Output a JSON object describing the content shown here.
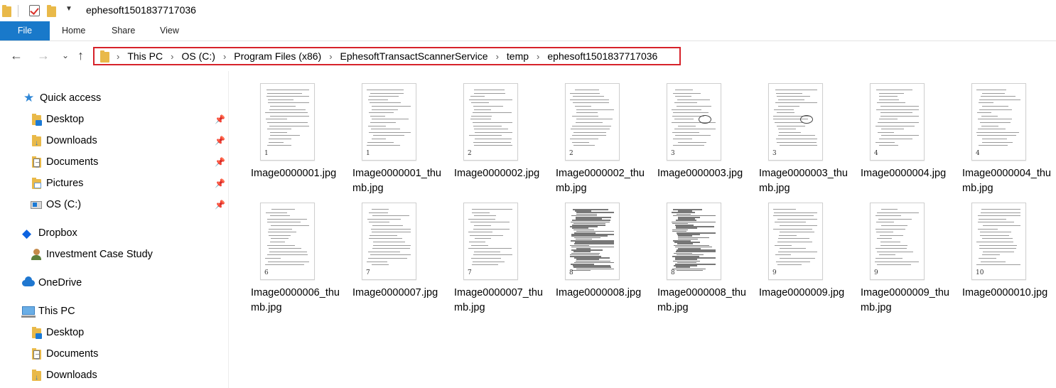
{
  "window": {
    "title": "ephesoft1501837717036"
  },
  "ribbon": {
    "tabs": [
      {
        "label": "File"
      },
      {
        "label": "Home"
      },
      {
        "label": "Share"
      },
      {
        "label": "View"
      }
    ]
  },
  "address_bar": {
    "breadcrumbs": [
      {
        "label": "This PC"
      },
      {
        "label": "OS (C:)"
      },
      {
        "label": "Program Files (x86)"
      },
      {
        "label": "EphesoftTransactScannerService"
      },
      {
        "label": "temp"
      },
      {
        "label": "ephesoft1501837717036"
      }
    ],
    "highlight_color": "#d6222a"
  },
  "sidebar": {
    "items": [
      {
        "label": "Quick access",
        "icon": "star-icon"
      },
      {
        "label": "Desktop",
        "icon": "desktop-folder-icon",
        "pinned": true
      },
      {
        "label": "Downloads",
        "icon": "downloads-folder-icon",
        "pinned": true
      },
      {
        "label": "Documents",
        "icon": "documents-folder-icon",
        "pinned": true
      },
      {
        "label": "Pictures",
        "icon": "pictures-folder-icon",
        "pinned": true
      },
      {
        "label": "OS (C:)",
        "icon": "drive-icon",
        "pinned": true
      },
      {
        "label": "Dropbox",
        "icon": "dropbox-icon"
      },
      {
        "label": "Investment Case Study",
        "icon": "shared-folder-icon"
      },
      {
        "label": "OneDrive",
        "icon": "cloud-icon"
      },
      {
        "label": "This PC",
        "icon": "computer-icon"
      },
      {
        "label": "Desktop",
        "icon": "desktop-folder-icon"
      },
      {
        "label": "Documents",
        "icon": "documents-folder-icon"
      },
      {
        "label": "Downloads",
        "icon": "downloads-folder-icon"
      }
    ]
  },
  "files": [
    {
      "name": "Image0000001.jpg",
      "mark": "1"
    },
    {
      "name": "Image0000001_thumb.jpg",
      "mark": "1"
    },
    {
      "name": "Image0000002.jpg",
      "mark": "2"
    },
    {
      "name": "Image0000002_thumb.jpg",
      "mark": "2"
    },
    {
      "name": "Image0000003.jpg",
      "mark": "3"
    },
    {
      "name": "Image0000003_thumb.jpg",
      "mark": "3"
    },
    {
      "name": "Image0000004.jpg",
      "mark": "4"
    },
    {
      "name": "Image0000004_thumb.jpg",
      "mark": "4"
    },
    {
      "name": "Image0000006_thumb.jpg",
      "mark": "6"
    },
    {
      "name": "Image0000007.jpg",
      "mark": "7"
    },
    {
      "name": "Image0000007_thumb.jpg",
      "mark": "7"
    },
    {
      "name": "Image0000008.jpg",
      "mark": "8"
    },
    {
      "name": "Image0000008_thumb.jpg",
      "mark": "8"
    },
    {
      "name": "Image0000009.jpg",
      "mark": "9"
    },
    {
      "name": "Image0000009_thumb.jpg",
      "mark": "9"
    },
    {
      "name": "Image0000010.jpg",
      "mark": "10"
    }
  ],
  "colors": {
    "file_tab": "#1979ca",
    "folder": "#e9b949",
    "accent": "#1b7ad6"
  }
}
